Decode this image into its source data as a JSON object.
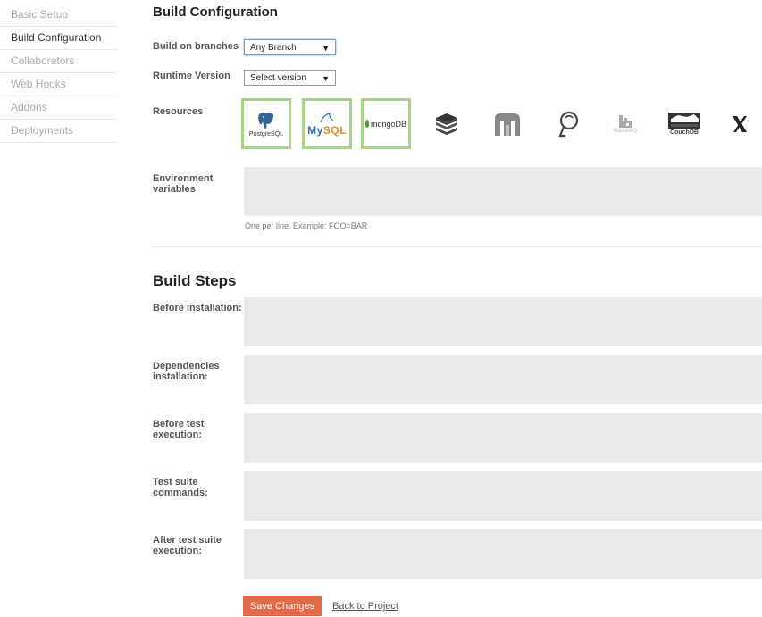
{
  "sidebar": {
    "items": [
      {
        "label": "Basic Setup"
      },
      {
        "label": "Build Configuration"
      },
      {
        "label": "Collaborators"
      },
      {
        "label": "Web Hooks"
      },
      {
        "label": "Addons"
      },
      {
        "label": "Deployments"
      }
    ],
    "active_index": 1
  },
  "build_config": {
    "title": "Build Configuration",
    "branches_label": "Build on branches",
    "branches_value": "Any Branch",
    "runtime_label": "Runtime Version",
    "runtime_value": "Select version",
    "resources_label": "Resources",
    "resources": [
      {
        "name": "PostgreSQL",
        "selected": true,
        "icon": "postgresql-icon"
      },
      {
        "name": "MySQL",
        "selected": true,
        "icon": "mysql-icon"
      },
      {
        "name": "mongoDB",
        "selected": true,
        "icon": "mongodb-icon"
      },
      {
        "name": "",
        "selected": false,
        "icon": "redis-icon"
      },
      {
        "name": "",
        "selected": false,
        "icon": "memcached-icon"
      },
      {
        "name": "",
        "selected": false,
        "icon": "elasticsearch-icon"
      },
      {
        "name": "RabbitMQ",
        "selected": false,
        "icon": "rabbitmq-icon"
      },
      {
        "name": "CouchDB",
        "selected": false,
        "icon": "couchdb-icon"
      },
      {
        "name": "",
        "selected": false,
        "icon": "xvfb-icon"
      }
    ],
    "env_label_line1": "Environment",
    "env_label_line2": "variables",
    "env_hint": "One per line. Example: FOO=BAR"
  },
  "build_steps": {
    "title": "Build Steps",
    "steps": [
      {
        "line1": "Before installation:",
        "line2": ""
      },
      {
        "line1": "Dependencies",
        "line2": "installation:"
      },
      {
        "line1": "Before test",
        "line2": "execution:"
      },
      {
        "line1": "Test suite",
        "line2": "commands:"
      },
      {
        "line1": "After test suite",
        "line2": "execution:"
      }
    ]
  },
  "actions": {
    "save_label": "Save Changes",
    "back_label": "Back to Project"
  },
  "colors": {
    "accent": "#e36b49",
    "selected_border": "#a9d38b",
    "field_bg": "#eaeaea"
  }
}
